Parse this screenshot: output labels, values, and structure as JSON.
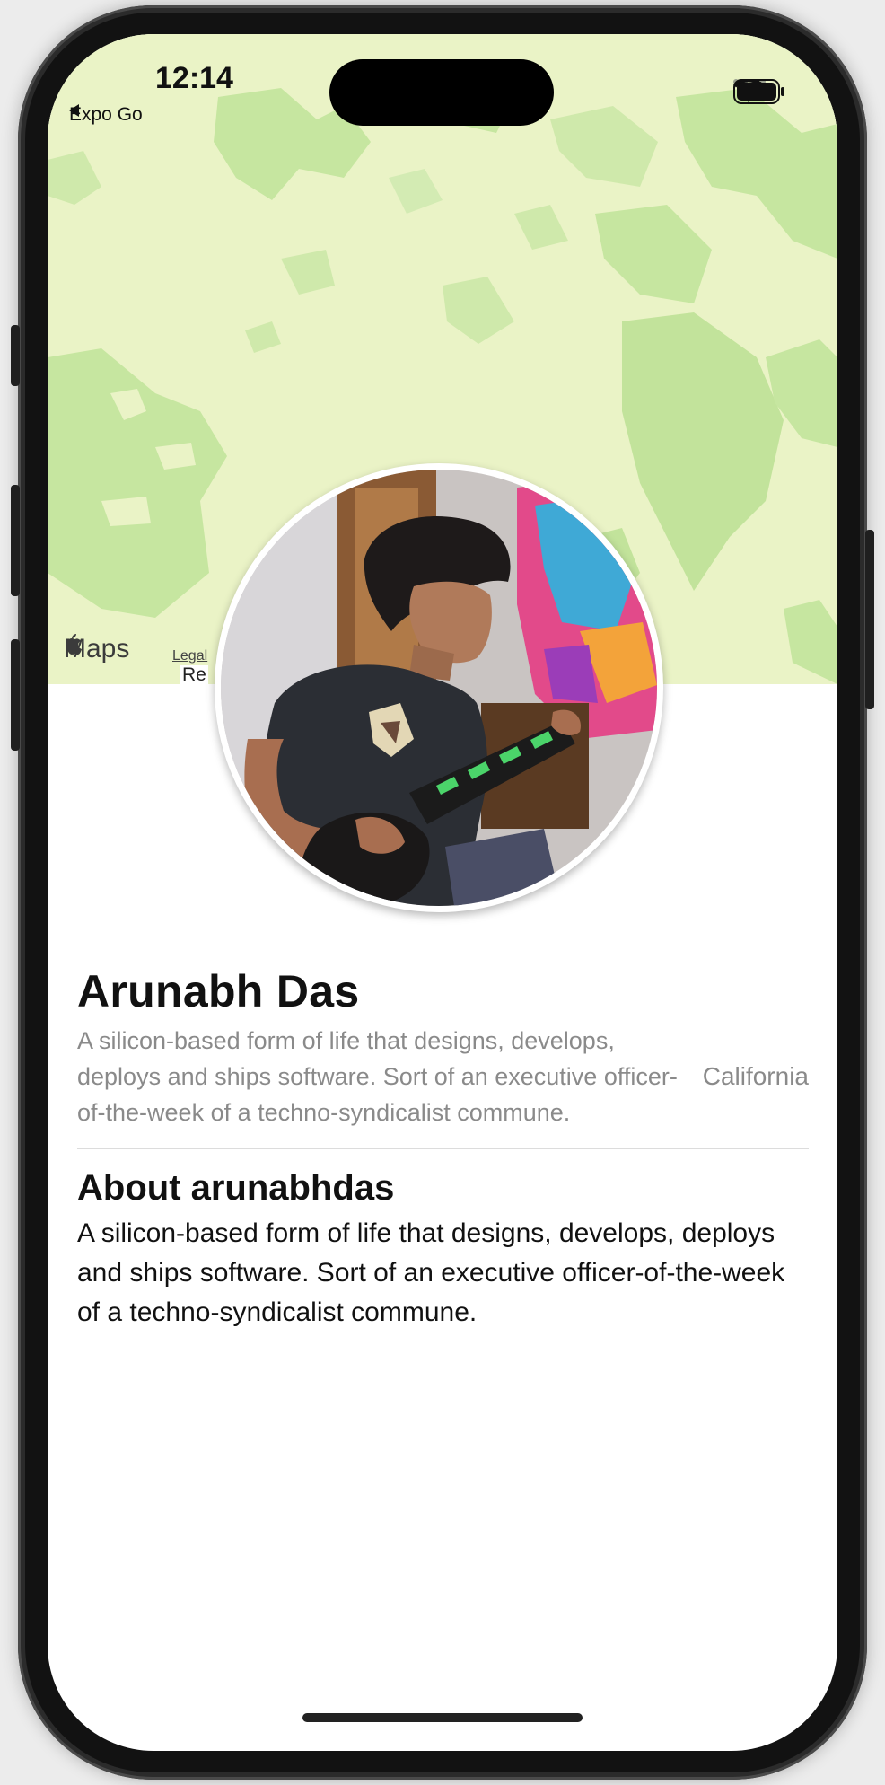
{
  "status_bar": {
    "time": "12:14",
    "back_app": "Expo Go"
  },
  "map": {
    "brand": "Maps",
    "legal": "Legal",
    "road_label": "Re"
  },
  "profile": {
    "name": "Arunabh Das",
    "tagline": "A silicon-based form of life that designs, develops, deploys and ships software. Sort of an executive officer-of-the-week of a techno-syndicalist commune.",
    "location": "California"
  },
  "about": {
    "title": "About arunabhdas",
    "body": "A silicon-based form of life that designs, develops, deploys and ships software. Sort of an executive officer-of-the-week of a techno-syndicalist commune."
  },
  "colors": {
    "map_base": "#eaf3c6",
    "map_forest": "#c6e6a0",
    "secondary_text": "#8a8a8a",
    "primary_text": "#111111"
  },
  "icons": [
    "back-arrow-icon",
    "wifi-icon",
    "battery-icon",
    "apple-logo-icon"
  ]
}
